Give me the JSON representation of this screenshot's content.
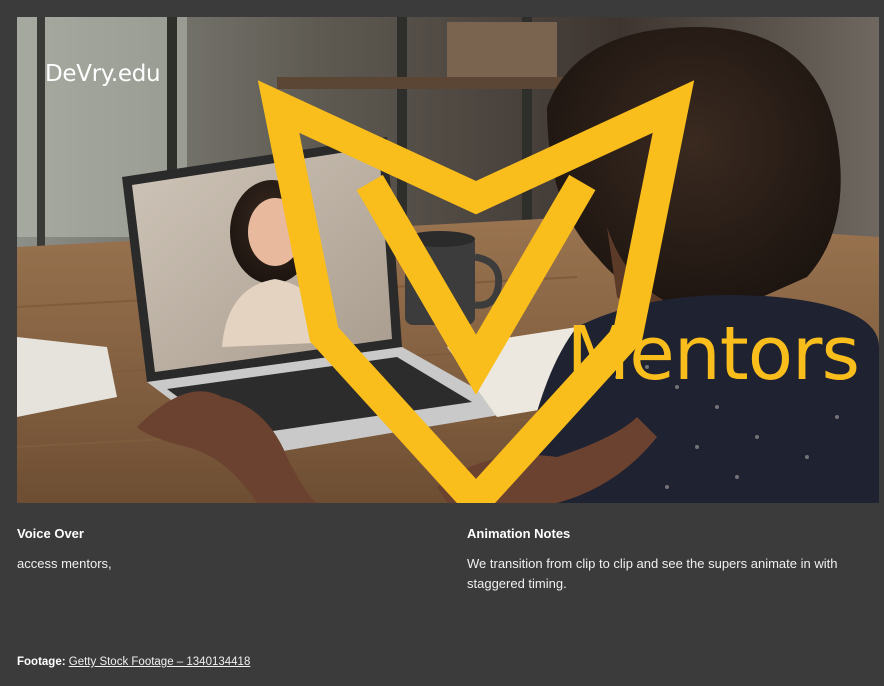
{
  "brand": {
    "logo_text": "DeVry.edu",
    "logo_icon": "devry-shield-logo-icon",
    "accent_color": "#f9bd1c"
  },
  "hero": {
    "super_text": "Mentors",
    "image_description_icon": "video-call-photo"
  },
  "voice_over": {
    "title": "Voice Over",
    "body": "access mentors,"
  },
  "animation_notes": {
    "title": "Animation Notes",
    "body": "We transition from clip to clip and see the supers animate in with staggered timing."
  },
  "footage": {
    "label": "Footage:",
    "link_text": "Getty Stock Footage – 1340134418"
  }
}
